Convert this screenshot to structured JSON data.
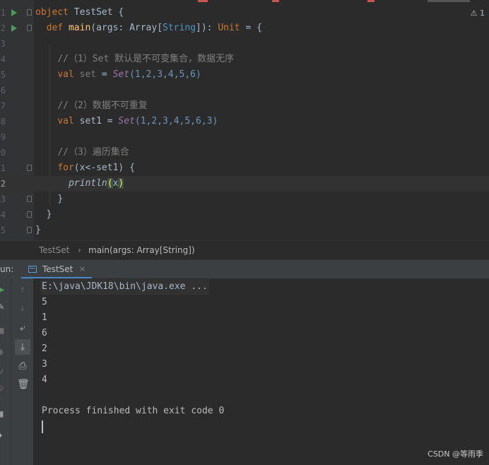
{
  "editor": {
    "warning_count": "1",
    "lines": [
      {
        "num": "1"
      },
      {
        "num": "2"
      },
      {
        "num": "3"
      },
      {
        "num": "4"
      },
      {
        "num": "5"
      },
      {
        "num": "6"
      },
      {
        "num": "7"
      },
      {
        "num": "8"
      },
      {
        "num": "9"
      },
      {
        "num": "0"
      },
      {
        "num": "1"
      },
      {
        "num": "2"
      },
      {
        "num": "3"
      },
      {
        "num": "4"
      },
      {
        "num": "5"
      }
    ],
    "code": {
      "l1_kw": "object",
      "l1_name": " TestSet {",
      "l2_kw": "def",
      "l2_fn": "main",
      "l2_a": "(args: Array[",
      "l2_ty": "String",
      "l2_b": "]): ",
      "l2_unit": "Unit",
      "l2_c": " = {",
      "l4_comment": "//（1）Set 默认是不可变集合，数据无序",
      "l5_kw": "val",
      "l5_var": " set",
      "l5_eq": " = ",
      "l5_set": "Set",
      "l5_args": "(1,2,3,4,5,6)",
      "l7_comment": "//（2）数据不可重复",
      "l8_kw": "val",
      "l8_var": " set1 = ",
      "l8_set": "Set",
      "l8_args": "(1,2,3,4,5,6,3)",
      "l10_comment": "//（3）遍历集合",
      "l11_kw": "for",
      "l11_rest": "(x<-set1) {",
      "l12_fn": "println",
      "l12_open": "(",
      "l12_x": "x",
      "l12_close": ")",
      "l13": "}",
      "l14": "}",
      "l15": "}"
    }
  },
  "breadcrumb": {
    "object": "TestSet",
    "separator": "›",
    "method": "main(args: Array[String])"
  },
  "run_panel": {
    "label": "un:",
    "tab_label": "TestSet",
    "tab_close": "×"
  },
  "console": {
    "command": "E:\\java\\JDK18\\bin\\java.exe ...",
    "outputs": [
      "5",
      "1",
      "6",
      "2",
      "3",
      "4"
    ],
    "finish": "Process finished with exit code 0"
  },
  "watermark": "CSDN @等雨季",
  "icons": {
    "run": "run-icon",
    "wrench": "wrench-icon",
    "stop": "stop-icon",
    "camera": "camera-icon",
    "up": "arrow-up-icon",
    "down": "arrow-down-icon",
    "wrap": "soft-wrap-icon",
    "scroll": "scroll-to-end-icon",
    "print": "print-icon",
    "trash": "trash-icon"
  }
}
